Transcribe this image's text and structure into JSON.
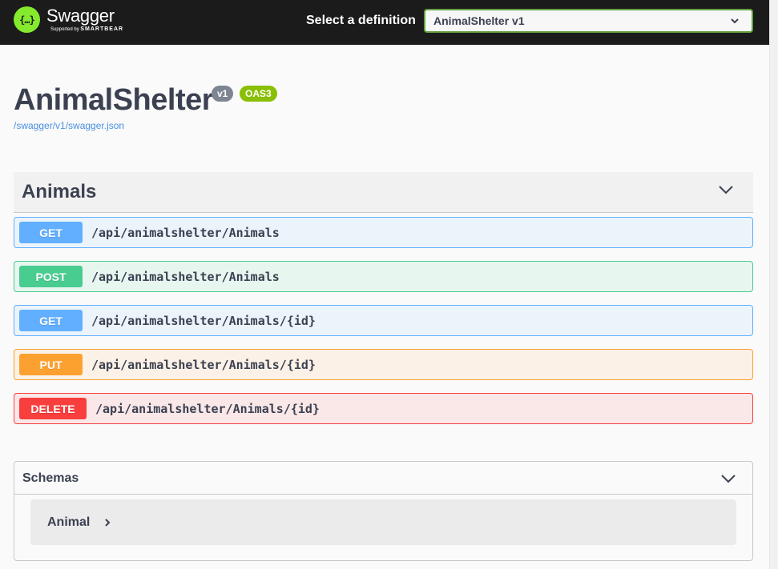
{
  "topbar": {
    "logo_symbol": "{…}",
    "logo_title": "Swagger",
    "logo_sub_prefix": "Supported by ",
    "logo_sub_brand": "SMARTBEAR",
    "definition_label": "Select a definition",
    "definition_value": "AnimalShelter v1"
  },
  "info": {
    "title": "AnimalShelter",
    "version_badge": "v1",
    "oas_badge": "OAS3",
    "spec_link": "/swagger/v1/swagger.json"
  },
  "tag": {
    "name": "Animals",
    "operations": [
      {
        "method": "GET",
        "path": "/api/animalshelter/Animals"
      },
      {
        "method": "POST",
        "path": "/api/animalshelter/Animals"
      },
      {
        "method": "GET",
        "path": "/api/animalshelter/Animals/{id}"
      },
      {
        "method": "PUT",
        "path": "/api/animalshelter/Animals/{id}"
      },
      {
        "method": "DELETE",
        "path": "/api/animalshelter/Animals/{id}"
      }
    ]
  },
  "schemas": {
    "title": "Schemas",
    "models": [
      {
        "name": "Animal"
      }
    ]
  },
  "colors": {
    "get": "#61affe",
    "post": "#49cc90",
    "put": "#fca130",
    "delete": "#f93e3e",
    "brand": "#85ea2d",
    "topbar": "#1b1b1b"
  },
  "icons": {
    "select_chevron": "chevron-down-icon",
    "tag_chevron": "chevron-down-icon",
    "schemas_chevron": "chevron-down-icon",
    "model_arrow": "chevron-right-icon"
  }
}
